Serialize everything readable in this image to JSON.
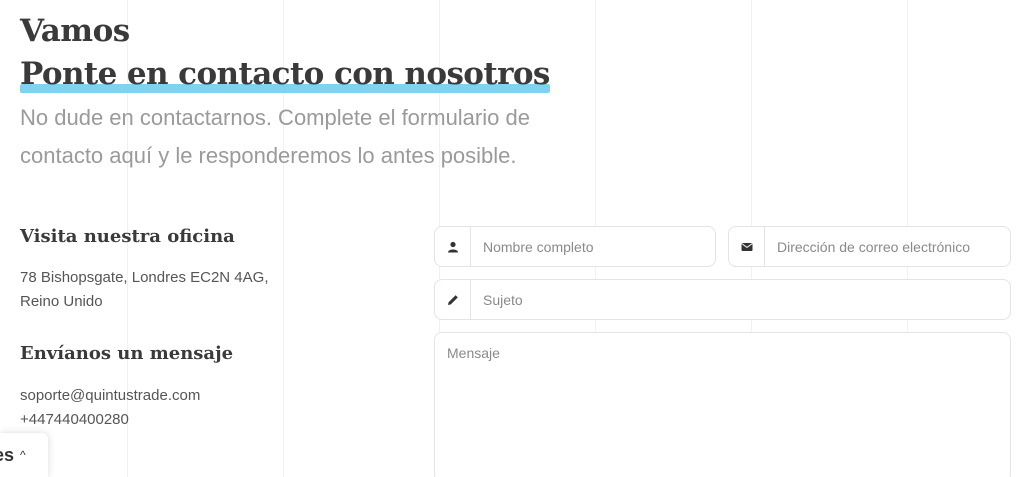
{
  "heading": {
    "line1": "Vamos",
    "line2": "Ponte en contacto con nosotros"
  },
  "lead": "No dude en contactarnos. Complete el formulario de contacto aquí y le responderemos lo antes posible.",
  "office": {
    "title": "Visita nuestra oficina",
    "address_line1": "78 Bishopsgate, Londres EC2N 4AG,",
    "address_line2": "Reino Unido"
  },
  "message_info": {
    "title": "Envíanos un mensaje",
    "email": "soporte@quintustrade.com",
    "phone": "+447440400280"
  },
  "form": {
    "name_placeholder": "Nombre completo",
    "email_placeholder": "Dirección de correo electrónico",
    "subject_placeholder": "Sujeto",
    "message_placeholder": "Mensaje"
  },
  "cookie_tab": {
    "label": "es",
    "chevron": "^"
  },
  "colors": {
    "highlight": "#7fd3f0",
    "lead_text": "#9a9a9a"
  }
}
